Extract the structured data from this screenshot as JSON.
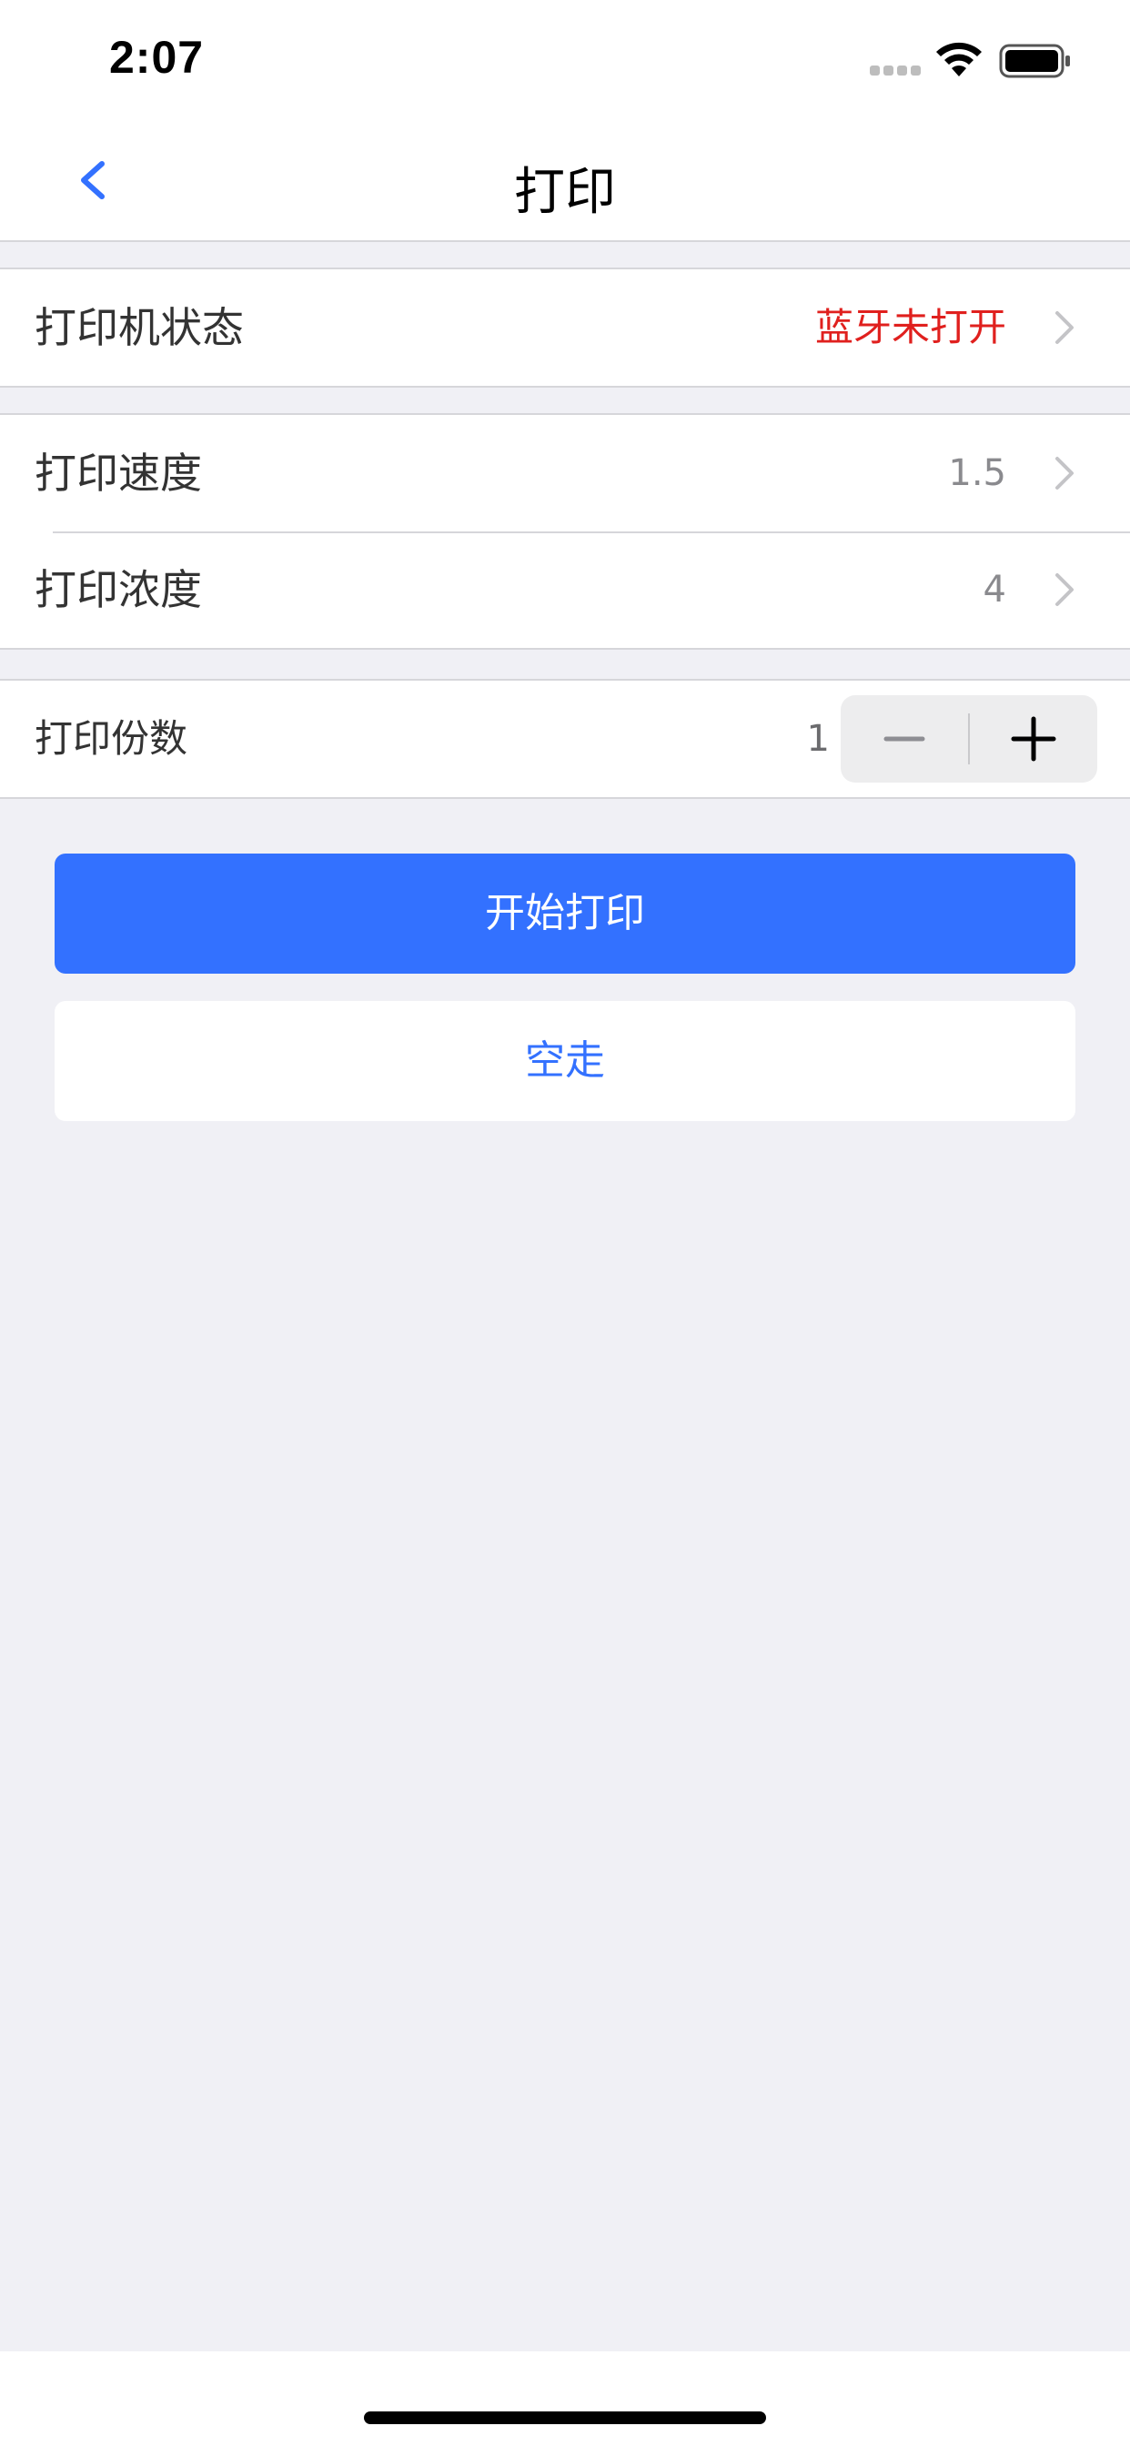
{
  "status_bar": {
    "time": "2:07"
  },
  "nav": {
    "title": "打印",
    "back_icon": "chevron-left-icon"
  },
  "printer_status": {
    "label": "打印机状态",
    "value": "蓝牙未打开",
    "value_color": "#E0201E"
  },
  "settings": [
    {
      "label": "打印速度",
      "value": "1.5"
    },
    {
      "label": "打印浓度",
      "value": "4"
    }
  ],
  "copies": {
    "label": "打印份数",
    "value": "1",
    "decrement_icon": "minus-icon",
    "increment_icon": "plus-icon"
  },
  "actions": {
    "print_label": "开始打印",
    "feed_label": "空走"
  },
  "colors": {
    "accent": "#3371FF",
    "background": "#F0F0F5",
    "alert": "#E0201E"
  }
}
